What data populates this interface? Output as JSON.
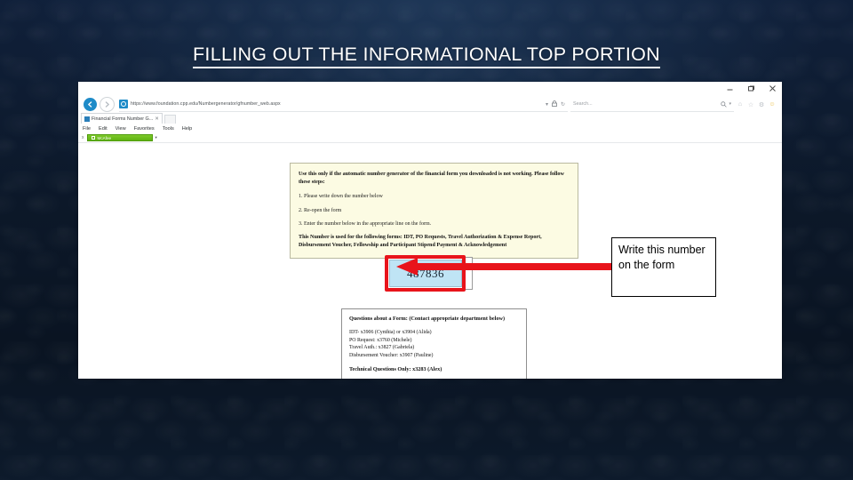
{
  "slide": {
    "title": "FILLING OUT THE INFORMATIONAL TOP PORTION",
    "background_color": "#0e1c2e",
    "title_color": "#ffffff"
  },
  "browser": {
    "window_controls": {
      "minimize": "–",
      "restore": "❐",
      "close": "✕"
    },
    "back_label": "←",
    "forward_label": "→",
    "url": "https://www.foundation.cpp.edu/Numbergenerator/gfnumber_web.aspx",
    "url_scheme": "https://",
    "url_rest": "www.foundation.cpp.edu/Numbergenerator/gfnumber_web.aspx",
    "refresh_icon": "↻",
    "tab": {
      "label": "Financial Forms Number G...",
      "close_label": "✕"
    },
    "new_tab_label": "",
    "search_placeholder": "Search...",
    "search_icon": "⚲",
    "menu_items": [
      {
        "label": "File"
      },
      {
        "label": "Edit"
      },
      {
        "label": "View"
      },
      {
        "label": "Favorites"
      },
      {
        "label": "Tools"
      },
      {
        "label": "Help"
      }
    ],
    "command_icons": [
      {
        "name": "home-icon",
        "glyph": "⌂"
      },
      {
        "name": "favorites-star-icon",
        "glyph": "☆"
      },
      {
        "name": "settings-gear-icon",
        "glyph": "⚙"
      },
      {
        "name": "smiley-feedback-icon",
        "glyph": "☺"
      }
    ],
    "mcafee": {
      "close_label": "x",
      "label": "McAfee",
      "caret": "▾",
      "accent_color": "#6fbe1e"
    }
  },
  "page": {
    "instructions": {
      "lead": "Use this only if the automatic number generator of the financial form you downloaded is not working. Please follow these steps:",
      "steps": [
        "1. Please write down the number below",
        "2. Re-open the form",
        "3. Enter the number below in the appropriate line on the form."
      ],
      "footer": "This Number is used for the following forms: IDT, PO Requests, Travel Authorization & Expense Report, Disbursement Voucher, Fellowship and Participant Stipend Payment & Acknowledgement",
      "background_color": "#fcfbe3"
    },
    "generated_number": "487836",
    "number_field_color": "#bfe4f5",
    "highlight_color": "#e8141b",
    "contacts": {
      "heading": "Questions about a Form: (Contact appropriate department below)",
      "lines": [
        "IDT- x3906 (Cynthia) or x3904 (Alida)",
        "PO Request: x3760 (Michele)",
        "Travel Auth.: x3827 (Gabriela)",
        "Disbursement Voucher: x3907 (Pauline)"
      ],
      "technical": "Technical Questions Only: x3283 (Alex)"
    }
  },
  "annotation": {
    "note_text": "Write this number on the form",
    "arrow_color": "#e8141b"
  }
}
